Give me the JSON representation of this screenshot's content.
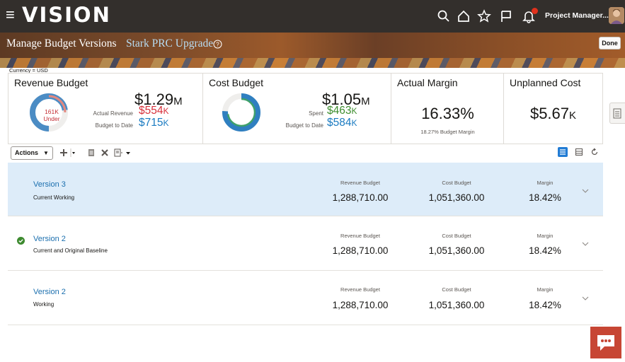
{
  "header": {
    "menu_glyph": "≡",
    "logo": "VISION",
    "user_name": "Project Manager... ∨",
    "icons": [
      "search-icon",
      "home-icon",
      "star-icon",
      "flag-icon",
      "notification-bell-icon",
      "user-avatar"
    ]
  },
  "banner": {
    "page_title": "Manage Budget Versions",
    "project_name": "Stark PRC Upgrade",
    "done_label": "Done"
  },
  "currency_label": "Currency = USD",
  "metrics": {
    "revenue": {
      "title": "Revenue Budget",
      "total_num": "$1.29",
      "total_unit": "M",
      "donut_line1": "161K",
      "donut_line2": "Under",
      "actual_label": "Actual Revenue",
      "actual_num": "$554",
      "actual_unit": "K",
      "to_date_label": "Budget to Date",
      "to_date_num": "$715",
      "to_date_unit": "K"
    },
    "cost": {
      "title": "Cost Budget",
      "total_num": "$1.05",
      "total_unit": "M",
      "spent_label": "Spent",
      "spent_num": "$463",
      "spent_unit": "K",
      "to_date_label": "Budget to Date",
      "to_date_num": "$584",
      "to_date_unit": "K"
    },
    "margin": {
      "title": "Actual Margin",
      "value": "16.33%",
      "sub": "18.27% Budget Margin"
    },
    "unplanned": {
      "title": "Unplanned Cost",
      "value_num": "$5.67",
      "value_unit": "K"
    }
  },
  "toolbar": {
    "actions_label": "Actions",
    "actions_caret": "▼"
  },
  "columns": {
    "revenue": "Revenue Budget",
    "cost": "Cost Budget",
    "margin": "Margin"
  },
  "versions": [
    {
      "name": "Version 3",
      "desc": "Current Working",
      "revenue": "1,288,710.00",
      "cost": "1,051,360.00",
      "margin": "18.42%"
    },
    {
      "name": "Version 2",
      "desc": "Current and Original Baseline",
      "revenue": "1,288,710.00",
      "cost": "1,051,360.00",
      "margin": "18.42%"
    },
    {
      "name": "Version 2",
      "desc": "Working",
      "revenue": "1,288,710.00",
      "cost": "1,051,360.00",
      "margin": "18.42%"
    }
  ],
  "colors": {
    "accent": "#1b7bc1",
    "negative": "#d8303b",
    "positive": "#3e8e2f",
    "selected_row": "#ddecf9",
    "chat_button": "#c74634",
    "topbar": "#332f2c"
  }
}
